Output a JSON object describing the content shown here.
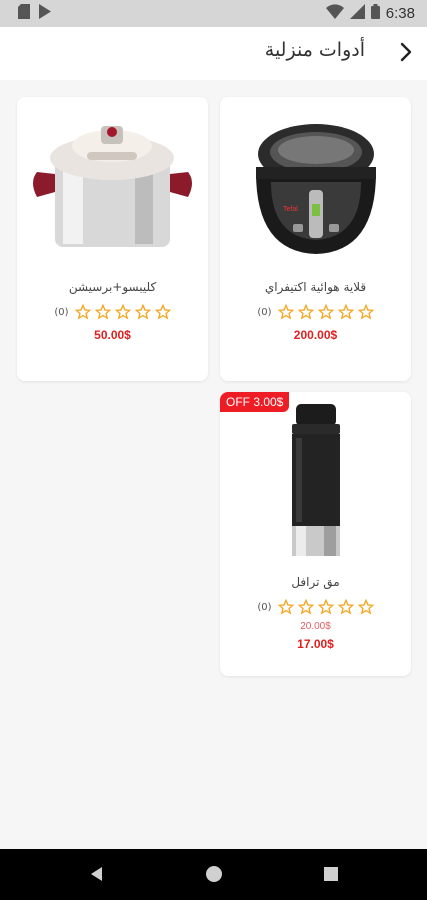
{
  "status_bar": {
    "time": "6:38",
    "icons": [
      "sd-card-icon",
      "play-store-icon",
      "wifi-icon",
      "signal-icon",
      "battery-icon"
    ]
  },
  "header": {
    "title": "أدوات منزلية",
    "back_icon": "chevron-right-icon"
  },
  "products": [
    {
      "name": "قلاية هوائية اكتيفراي",
      "rating_count": "(0)",
      "price": "200.00$",
      "image": "air-fryer"
    },
    {
      "name": "كليبسو+برسيشن",
      "rating_count": "(0)",
      "price": "50.00$",
      "image": "pressure-cooker"
    },
    {
      "name": "مق ترافل",
      "rating_count": "(0)",
      "old_price": "20.00$",
      "price": "17.00$",
      "badge": "OFF 3.00$",
      "image": "travel-mug"
    }
  ],
  "colors": {
    "accent": "#e02020",
    "star": "#f5a623",
    "badge": "#ee1c24"
  },
  "nav_bar": {
    "icons": [
      "back-triangle-icon",
      "home-circle-icon",
      "recents-square-icon"
    ]
  }
}
